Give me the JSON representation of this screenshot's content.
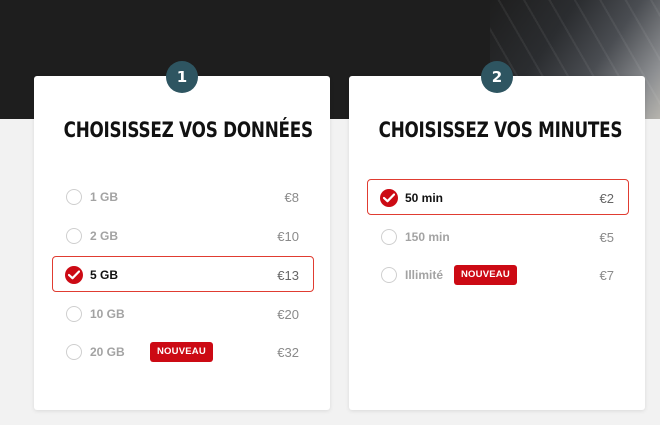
{
  "steps": [
    {
      "number": "1",
      "title": "CHOISISSEZ VOS DONNÉES",
      "options": [
        {
          "label": "1 GB",
          "price": "€8",
          "selected": false,
          "badge": ""
        },
        {
          "label": "2 GB",
          "price": "€10",
          "selected": false,
          "badge": ""
        },
        {
          "label": "5 GB",
          "price": "€13",
          "selected": true,
          "badge": ""
        },
        {
          "label": "10 GB",
          "price": "€20",
          "selected": false,
          "badge": ""
        },
        {
          "label": "20 GB",
          "price": "€32",
          "selected": false,
          "badge": "NOUVEAU"
        }
      ]
    },
    {
      "number": "2",
      "title": "CHOISISSEZ VOS MINUTES",
      "options": [
        {
          "label": "50 min",
          "price": "€2",
          "selected": true,
          "badge": ""
        },
        {
          "label": "150 min",
          "price": "€5",
          "selected": false,
          "badge": ""
        },
        {
          "label": "Illimité",
          "price": "€7",
          "selected": false,
          "badge": "NOUVEAU"
        }
      ]
    }
  ],
  "colors": {
    "accent_red": "#cc0a14",
    "selected_border": "#e03c31",
    "step_badge": "#2e5561",
    "hero_background": "#1e1e1e"
  }
}
